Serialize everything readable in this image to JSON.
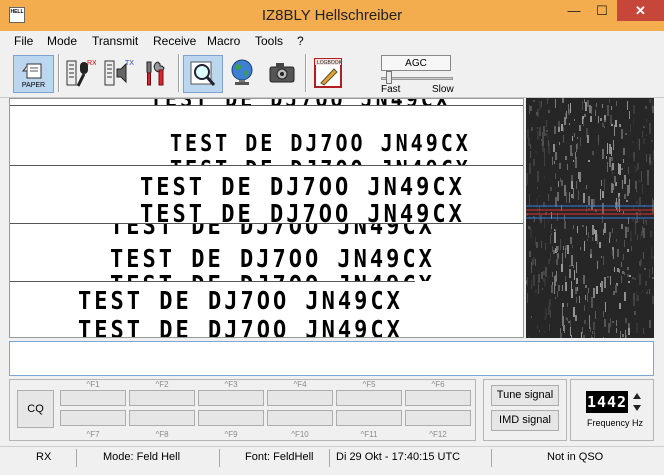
{
  "window": {
    "title": "IZ8BLY Hellschreiber",
    "icon_label": "HELL",
    "minimize_symbol": "—",
    "maximize_symbol": "☐",
    "close_symbol": "✕"
  },
  "menu": [
    "File",
    "Mode",
    "Transmit",
    "Receive",
    "Macro",
    "Tools",
    "?"
  ],
  "toolbar": {
    "paper_label": "PAPER",
    "buttons": [
      {
        "name": "paper-icon",
        "pressed": true
      },
      {
        "name": "transmit-microphone-icon",
        "pressed": false
      },
      {
        "name": "tx-speaker-icon",
        "pressed": false
      },
      {
        "name": "tools-icon",
        "pressed": false
      },
      {
        "name": "zoom-icon",
        "pressed": true
      },
      {
        "name": "globe-icon",
        "pressed": false
      },
      {
        "name": "camera-icon",
        "pressed": false
      },
      {
        "name": "logbook-icon",
        "pressed": false
      }
    ],
    "agc_label": "AGC",
    "agc_fast": "Fast",
    "agc_slow": "Slow",
    "agc_level": 0.08
  },
  "receive": {
    "line": "TEST DE DJ7OO JN49CX"
  },
  "macros": {
    "cq_label": "CQ",
    "top_keys": [
      "^F1",
      "^F2",
      "^F3",
      "^F4",
      "^F5",
      "^F6"
    ],
    "bottom_keys": [
      "^F7",
      "^F8",
      "^F9",
      "^F10",
      "^F11",
      "^F12"
    ]
  },
  "signal": {
    "tune_label": "Tune signal",
    "imd_label": "IMD signal"
  },
  "frequency": {
    "value": "1442",
    "label": "Frequency Hz"
  },
  "status": {
    "rx": "RX",
    "mode": "Mode: Feld Hell",
    "font": "Font: FeldHell",
    "datetime": "Di 29 Okt - 17:40:15 UTC",
    "qso": "Not in QSO"
  },
  "colors": {
    "title_bar": "#f3ad4e",
    "close_button": "#c7463a",
    "waterfall_marker_red": "#e03030",
    "waterfall_marker_blue": "#3a7fe0"
  }
}
